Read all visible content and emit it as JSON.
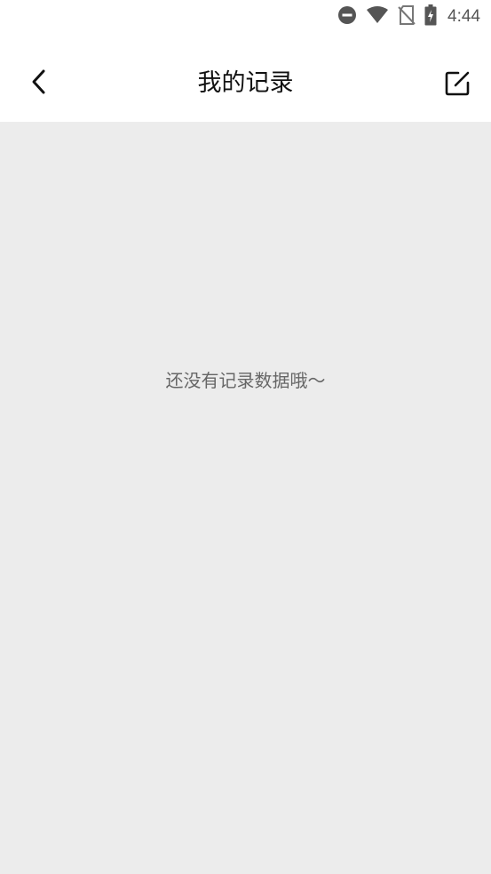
{
  "status_bar": {
    "time": "4:44",
    "icons": [
      "do-not-disturb-icon",
      "wifi-icon",
      "no-sim-icon",
      "battery-charging-icon"
    ]
  },
  "app_bar": {
    "title": "我的记录",
    "back_icon": "chevron-left-icon",
    "edit_icon": "edit-icon"
  },
  "content": {
    "empty_message": "还没有记录数据哦～"
  },
  "colors": {
    "background": "#ececec",
    "app_bar": "#ffffff",
    "title_text": "#111111",
    "empty_text": "#666666",
    "status_icons": "#555555"
  }
}
